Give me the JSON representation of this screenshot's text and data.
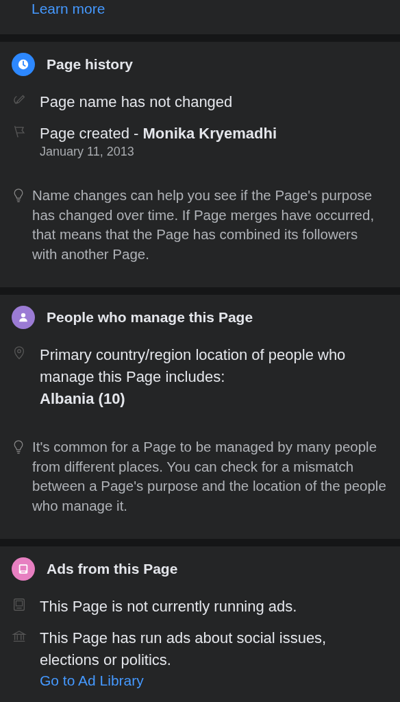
{
  "top_link": "Learn more",
  "sections": [
    {
      "title": "Page history",
      "kind": "clock",
      "color": "#2d88ff",
      "items": [
        {
          "kind": "rename",
          "text": "Page name has not changed"
        },
        {
          "kind": "flag",
          "text": "Page created - **Monika Kryemadhi**",
          "subtext": "January 11, 2013"
        }
      ],
      "tip": "Name changes can help you see if the Page's purpose has changed over time. If Page merges have occurred, that means that the Page has combined its followers with another Page."
    },
    {
      "title": "People who manage this Page",
      "kind": "person",
      "color": "#9b7bd4",
      "items": [
        {
          "kind": "pin",
          "text": "Primary country/region location of people who manage this Page includes:",
          "subtext_bold": "Albania (10)"
        }
      ],
      "tip": "It's common for a Page to be managed by many people from different places. You can check for a mismatch between a Page's purpose and the location of the people who manage it."
    },
    {
      "title": "Ads from this Page",
      "kind": "screen",
      "color": "#e77fc1",
      "items": [
        {
          "kind": "screen",
          "text": "This Page is not currently running ads."
        },
        {
          "kind": "bank",
          "text": "This Page has run ads about social issues, elections or politics.",
          "link": "Go to Ad Library"
        }
      ]
    }
  ]
}
